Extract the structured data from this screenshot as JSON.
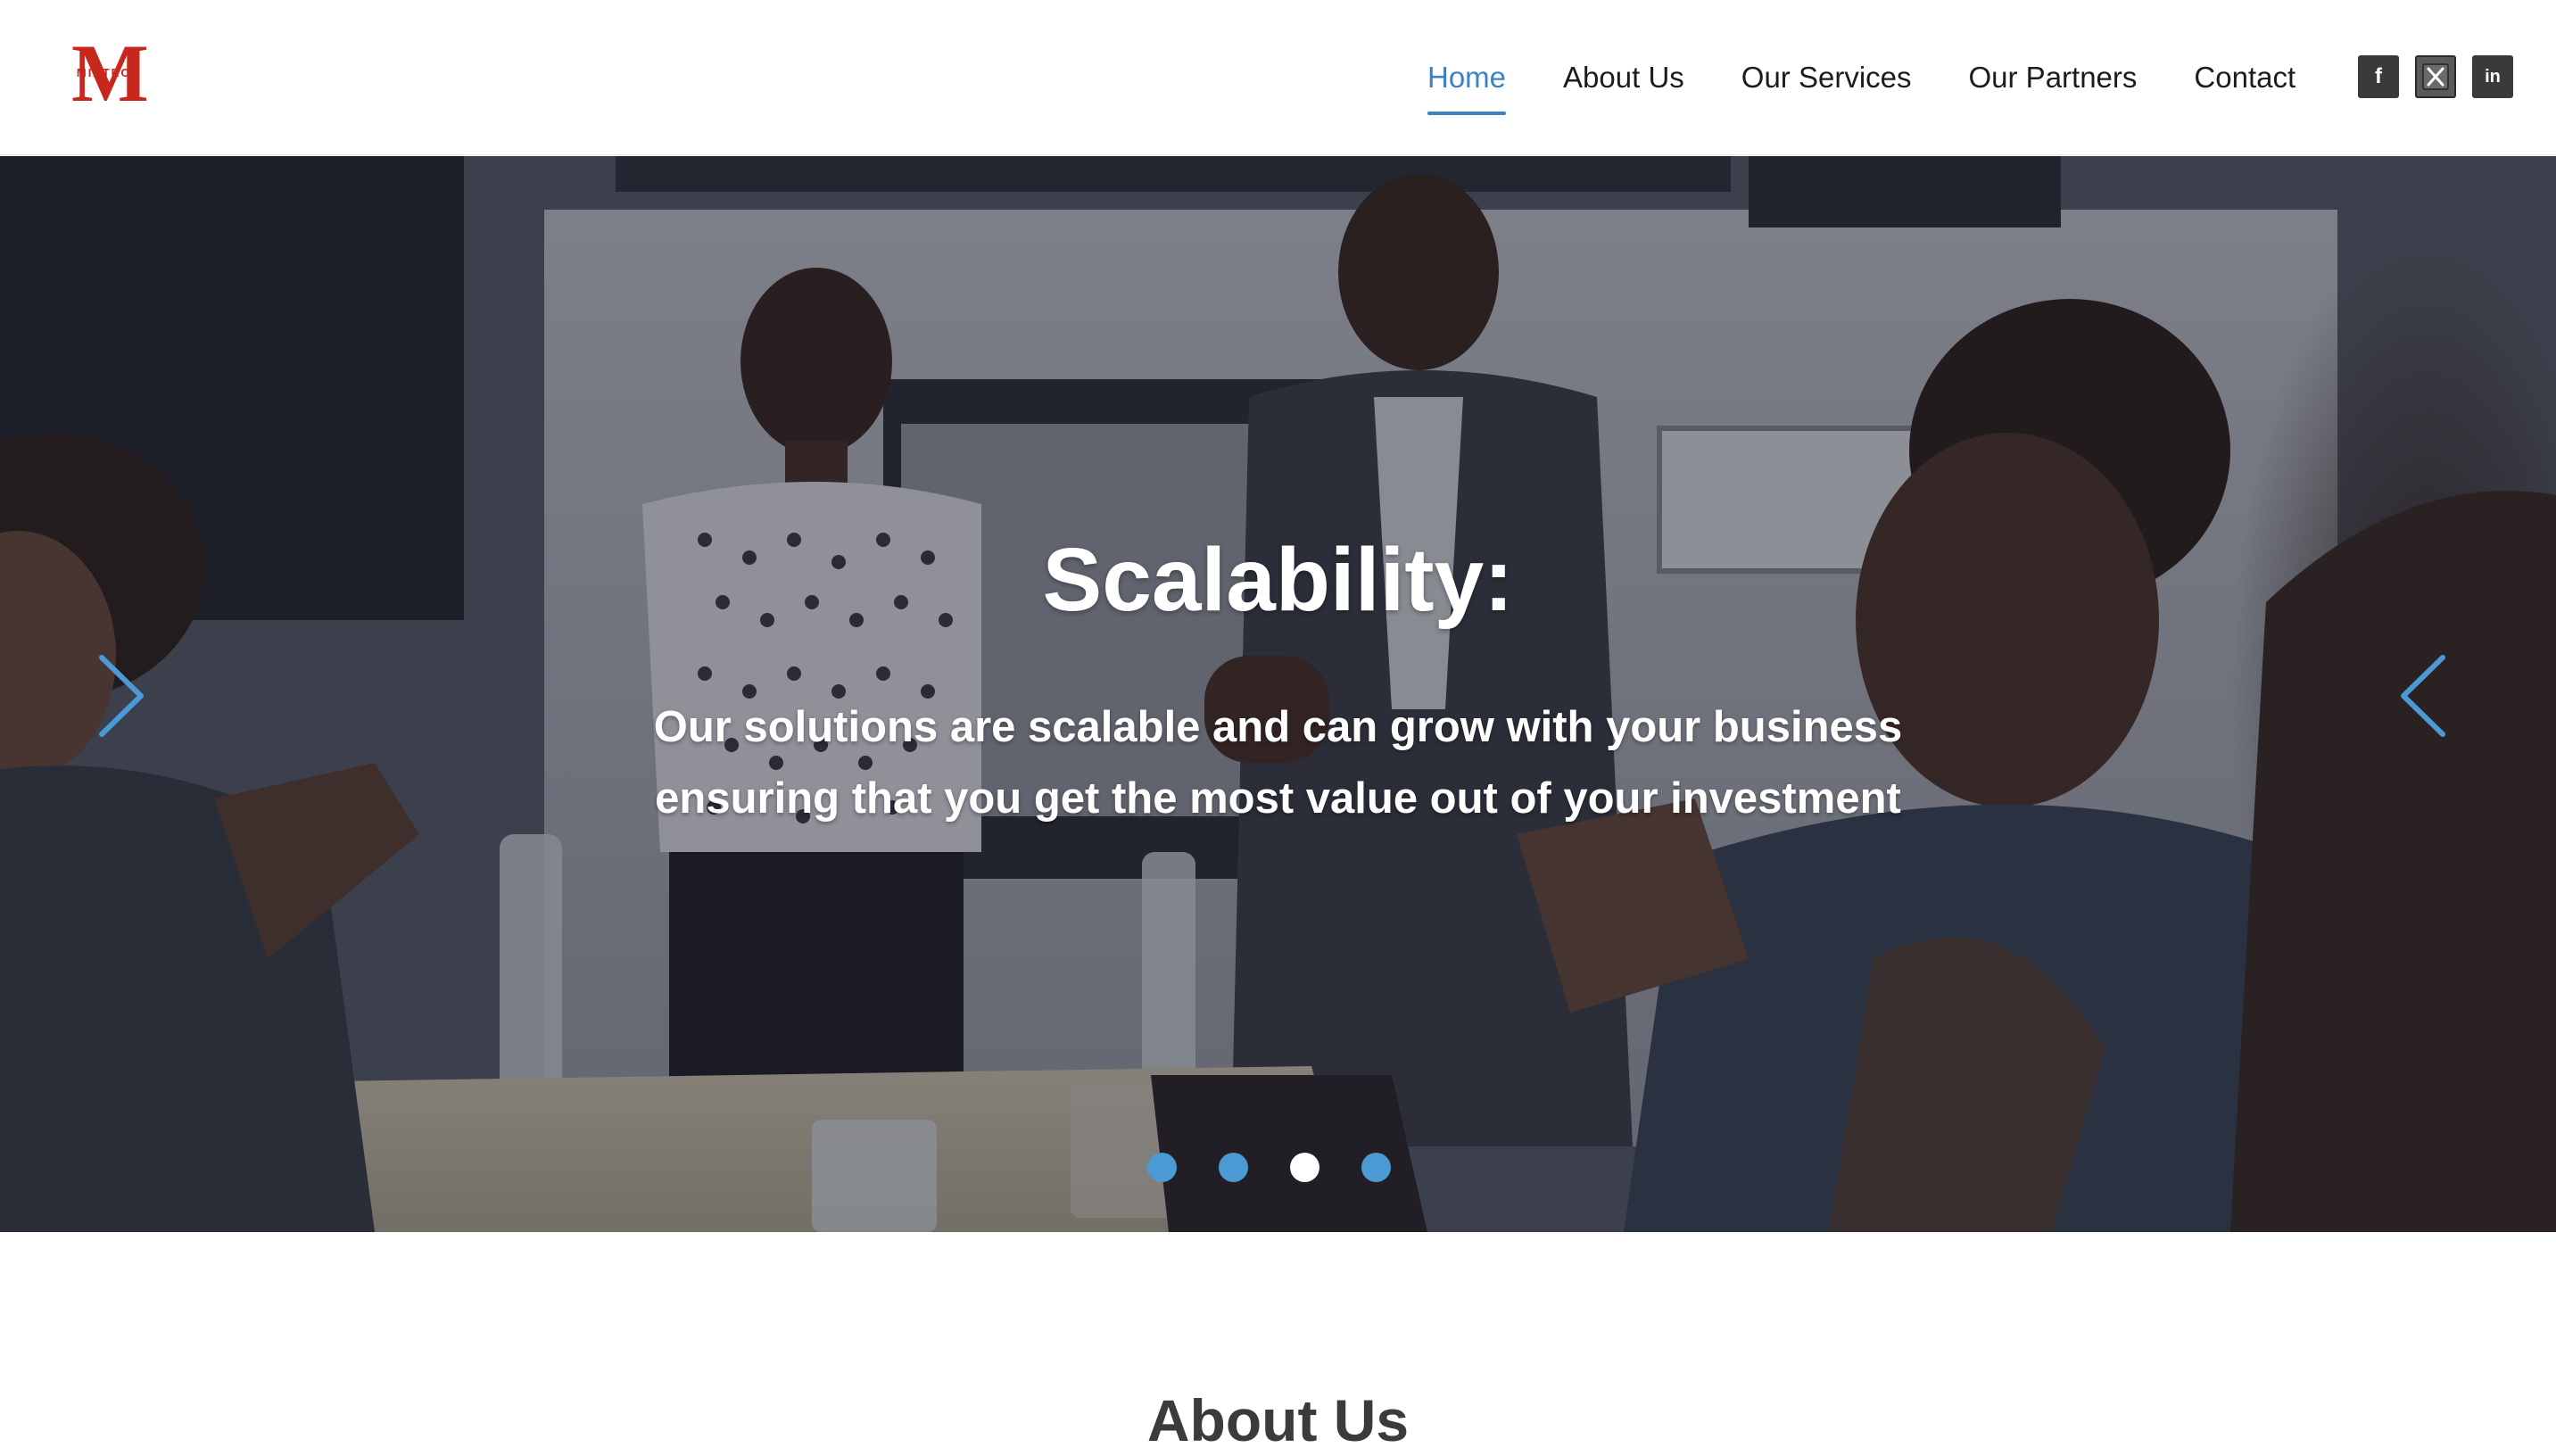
{
  "brand": {
    "logo_letter": "M",
    "logo_word": "MIATECH",
    "color": "#c8271e"
  },
  "nav": {
    "items": [
      {
        "label": "Home",
        "active": true
      },
      {
        "label": "About Us",
        "active": false
      },
      {
        "label": "Our Services",
        "active": false
      },
      {
        "label": "Our Partners",
        "active": false
      },
      {
        "label": "Contact",
        "active": false
      }
    ],
    "active_color": "#3d82c4"
  },
  "social": {
    "icons": [
      "facebook-icon",
      "x-twitter-icon",
      "linkedin-icon"
    ],
    "facebook_glyph": "f",
    "linkedin_glyph": "in"
  },
  "hero": {
    "title": "Scalability:",
    "text": "Our solutions are scalable and can grow with your business ensuring that you get the most value out of your investment",
    "slides_count": 4,
    "active_slide": 3,
    "dot_color": "#4b9ad6",
    "arrow_color": "#4b9ad6"
  },
  "about": {
    "title": "About Us"
  }
}
